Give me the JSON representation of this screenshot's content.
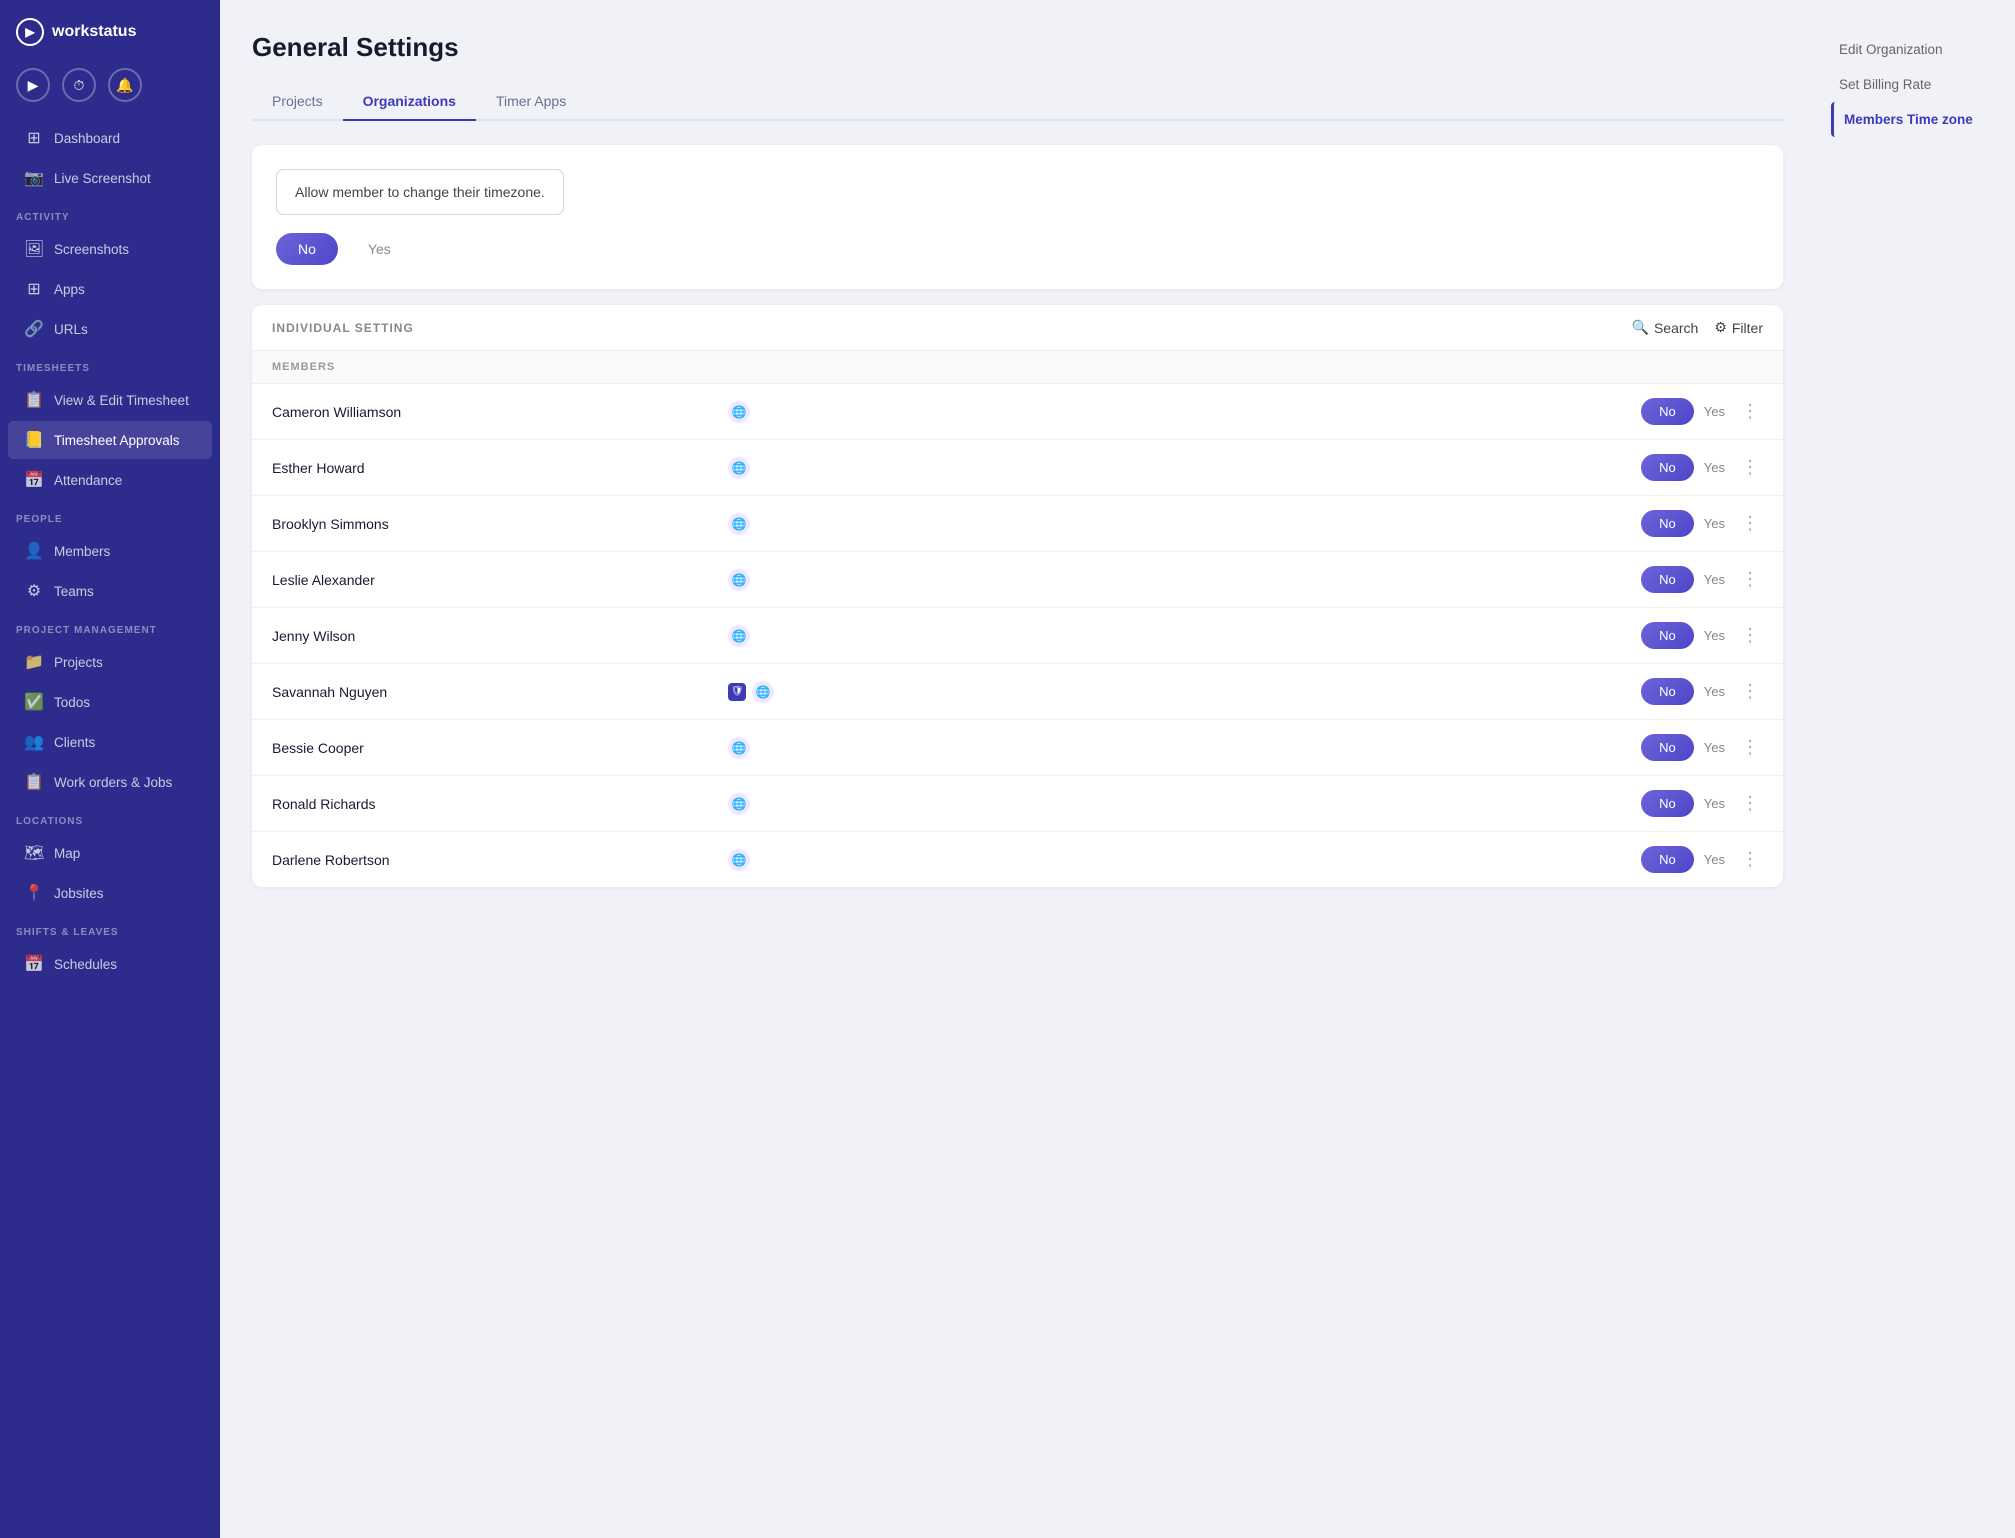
{
  "app": {
    "name": "workstatus"
  },
  "sidebar_icons": [
    "▶",
    "⏱",
    "🔔"
  ],
  "sidebar_sections": [
    {
      "label": "",
      "items": [
        {
          "id": "dashboard",
          "icon": "⊞",
          "label": "Dashboard"
        },
        {
          "id": "live-screenshot",
          "icon": "📷",
          "label": "Live Screenshot"
        }
      ]
    },
    {
      "label": "ACTIVITY",
      "items": [
        {
          "id": "screenshots",
          "icon": "🖼",
          "label": "Screenshots"
        },
        {
          "id": "apps",
          "icon": "⊞",
          "label": "Apps"
        },
        {
          "id": "urls",
          "icon": "🔗",
          "label": "URLs"
        }
      ]
    },
    {
      "label": "TIMESHEETS",
      "items": [
        {
          "id": "view-edit-timesheet",
          "icon": "📋",
          "label": "View & Edit Timesheet"
        },
        {
          "id": "timesheet-approvals",
          "icon": "📒",
          "label": "Timesheet Approvals"
        },
        {
          "id": "attendance",
          "icon": "📅",
          "label": "Attendance"
        }
      ]
    },
    {
      "label": "PEOPLE",
      "items": [
        {
          "id": "members",
          "icon": "👤",
          "label": "Members"
        },
        {
          "id": "teams",
          "icon": "⚙",
          "label": "Teams"
        }
      ]
    },
    {
      "label": "PROJECT MANAGEMENT",
      "items": [
        {
          "id": "projects",
          "icon": "📁",
          "label": "Projects"
        },
        {
          "id": "todos",
          "icon": "✅",
          "label": "Todos"
        },
        {
          "id": "clients",
          "icon": "👥",
          "label": "Clients"
        },
        {
          "id": "work-orders",
          "icon": "📋",
          "label": "Work orders & Jobs"
        }
      ]
    },
    {
      "label": "LOCATIONS",
      "items": [
        {
          "id": "map",
          "icon": "🗺",
          "label": "Map"
        },
        {
          "id": "jobsites",
          "icon": "📍",
          "label": "Jobsites"
        }
      ]
    },
    {
      "label": "SHIFTS & LEAVES",
      "items": [
        {
          "id": "schedules",
          "icon": "📅",
          "label": "Schedules"
        }
      ]
    }
  ],
  "page": {
    "title": "General Settings",
    "tabs": [
      {
        "id": "projects",
        "label": "Projects"
      },
      {
        "id": "organizations",
        "label": "Organizations"
      },
      {
        "id": "timer-apps",
        "label": "Timer Apps"
      }
    ],
    "active_tab": "organizations"
  },
  "timezone_notice": "Allow member to change their timezone.",
  "toggle": {
    "no_label": "No",
    "yes_label": "Yes"
  },
  "individual_section": {
    "label": "INDIVIDUAL SETTING",
    "search_label": "Search",
    "filter_label": "Filter",
    "members_header": "MEMBERS"
  },
  "members": [
    {
      "name": "Cameron Williamson",
      "has_shield": false
    },
    {
      "name": "Esther Howard",
      "has_shield": false
    },
    {
      "name": "Brooklyn Simmons",
      "has_shield": false
    },
    {
      "name": "Leslie Alexander",
      "has_shield": false
    },
    {
      "name": "Jenny Wilson",
      "has_shield": false
    },
    {
      "name": "Savannah Nguyen",
      "has_shield": true
    },
    {
      "name": "Bessie Cooper",
      "has_shield": false
    },
    {
      "name": "Ronald Richards",
      "has_shield": false
    },
    {
      "name": "Darlene Robertson",
      "has_shield": false
    }
  ],
  "right_panel": {
    "items": [
      {
        "id": "edit-organization",
        "label": "Edit Organization"
      },
      {
        "id": "set-billing-rate",
        "label": "Set Billing Rate"
      },
      {
        "id": "members-time-zone",
        "label": "Members Time zone"
      }
    ],
    "active": "members-time-zone"
  }
}
